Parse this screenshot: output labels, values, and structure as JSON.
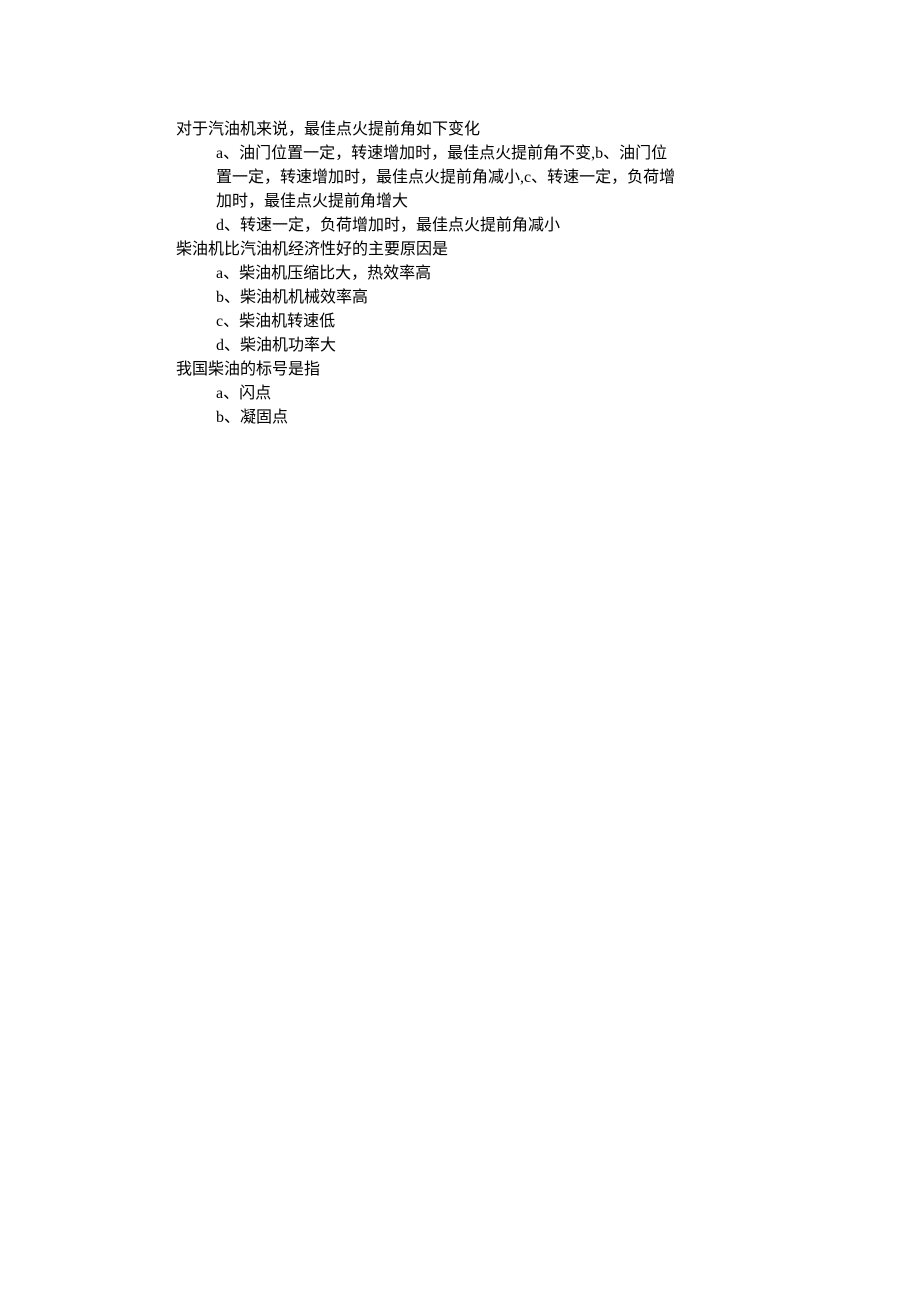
{
  "questions": [
    {
      "stem": "对于汽油机来说，最佳点火提前角如下变化",
      "options_lines": [
        "a、油门位置一定，转速增加时，最佳点火提前角不变,b、油门位置一定，转速增加时，最佳点火提前角减小,c、转速一定，负荷增加时，最佳点火提前角增大",
        "d、转速一定，负荷增加时，最佳点火提前角减小"
      ]
    },
    {
      "stem": "柴油机比汽油机经济性好的主要原因是",
      "options_lines": [
        "a、柴油机压缩比大，热效率高",
        "b、柴油机机械效率高",
        "c、柴油机转速低",
        "d、柴油机功率大"
      ]
    },
    {
      "stem": "我国柴油的标号是指",
      "options_lines": [
        "a、闪点",
        "b、凝固点"
      ]
    }
  ]
}
